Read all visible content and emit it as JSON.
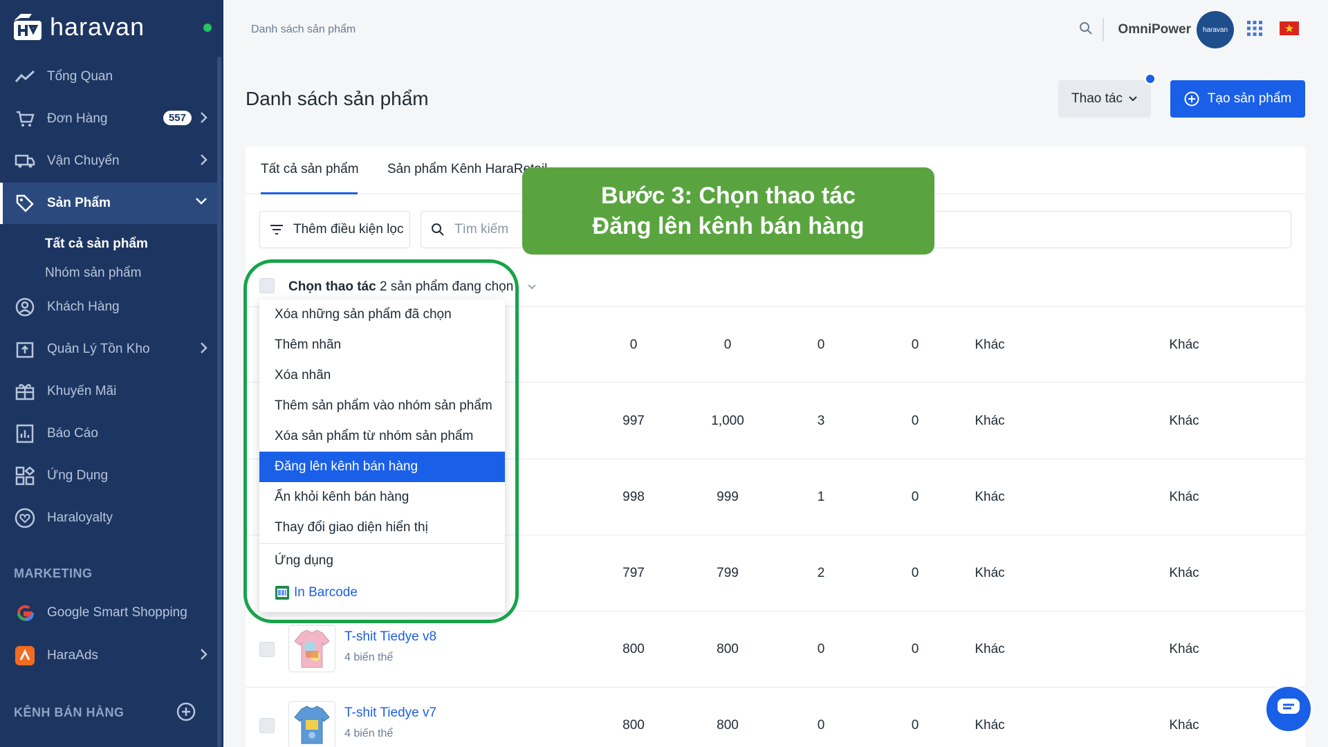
{
  "app": {
    "logo_text": "haravan"
  },
  "sidebar": {
    "items": [
      {
        "label": "Tổng Quan",
        "icon": "chart-line-icon"
      },
      {
        "label": "Đơn Hàng",
        "icon": "cart-icon",
        "badge": "557"
      },
      {
        "label": "Vận Chuyển",
        "icon": "truck-icon"
      },
      {
        "label": "Sản Phẩm",
        "icon": "tag-icon"
      },
      {
        "label": "Khách Hàng",
        "icon": "user-circle-icon"
      },
      {
        "label": "Quản Lý Tồn Kho",
        "icon": "inventory-icon"
      },
      {
        "label": "Khuyến Mãi",
        "icon": "gift-icon"
      },
      {
        "label": "Báo Cáo",
        "icon": "report-icon"
      },
      {
        "label": "Ứng Dụng",
        "icon": "apps-icon"
      },
      {
        "label": "Haraloyalty",
        "icon": "heart-icon"
      }
    ],
    "sub_items": [
      "Tất cả sản phẩm",
      "Nhóm sản phẩm"
    ],
    "marketing_title": "MARKETING",
    "marketing_items": [
      {
        "label": "Google Smart Shopping",
        "icon": "google-icon"
      },
      {
        "label": "HaraAds",
        "icon": "haraads-icon"
      }
    ],
    "channels_title": "KÊNH BÁN HÀNG"
  },
  "topbar": {
    "breadcrumb": "Danh sách sản phẩm",
    "user_name": "OmniPower",
    "avatar_text": "haravan"
  },
  "page": {
    "title": "Danh sách sản phẩm",
    "action_button": "Thao tác",
    "create_button": "Tạo sản phẩm"
  },
  "tabs": [
    "Tất cả sản phẩm",
    "Sản phẩm Kênh HaraRetail"
  ],
  "filter": {
    "button": "Thêm điều kiện lọc",
    "search_placeholder": "Tìm kiếm"
  },
  "selection": {
    "action_label": "Chọn thao tác",
    "count_text": "2 sản phẩm đang chọn"
  },
  "dropdown": {
    "items": [
      "Xóa những sản phẩm đã chọn",
      "Thêm nhãn",
      "Xóa nhãn",
      "Thêm sản phẩm vào nhóm sản phẩm",
      "Xóa sản phẩm từ nhóm sản phẩm",
      "Đăng lên kênh bán hàng",
      "Ẩn khỏi kênh bán hàng",
      "Thay đổi giao diện hiển thị"
    ],
    "apps_label": "Ứng dụng",
    "barcode_label": "In Barcode"
  },
  "rows": [
    {
      "name": "",
      "variants": "",
      "c1": "0",
      "c2": "0",
      "c3": "0",
      "c4": "0",
      "c5": "Khác",
      "c6": "Khác"
    },
    {
      "name": "",
      "variants": "",
      "c1": "997",
      "c2": "1,000",
      "c3": "3",
      "c4": "0",
      "c5": "Khác",
      "c6": "Khác"
    },
    {
      "name": "",
      "variants": "",
      "c1": "998",
      "c2": "999",
      "c3": "1",
      "c4": "0",
      "c5": "Khác",
      "c6": "Khác"
    },
    {
      "name": "",
      "variants": "",
      "c1": "797",
      "c2": "799",
      "c3": "2",
      "c4": "0",
      "c5": "Khác",
      "c6": "Khác"
    },
    {
      "name": "T-shit Tiedye v8",
      "variants": "4 biến thể",
      "c1": "800",
      "c2": "800",
      "c3": "0",
      "c4": "0",
      "c5": "Khác",
      "c6": "Khác"
    },
    {
      "name": "T-shit Tiedye v7",
      "variants": "4 biến thể",
      "c1": "800",
      "c2": "800",
      "c3": "0",
      "c4": "0",
      "c5": "Khác",
      "c6": "Khác"
    }
  ],
  "callout": {
    "line1": "Bước 3: Chọn thao tác",
    "line2": "Đăng lên kênh bán hàng"
  },
  "colors": {
    "sidebar": "#1d3561",
    "primary": "#1a5fe8",
    "callout": "#5aa440",
    "ring": "#17a34a"
  }
}
